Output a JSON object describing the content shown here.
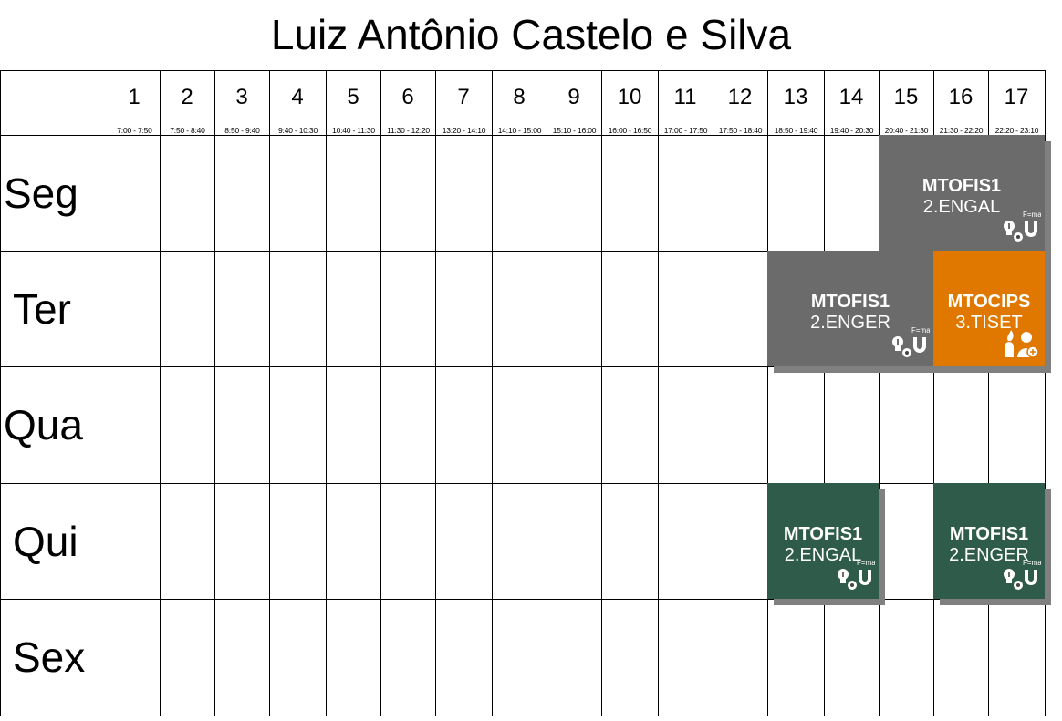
{
  "title": "Luiz Antônio Castelo e Silva",
  "columns": [
    {
      "num": "1",
      "time": "7:00 - 7:50"
    },
    {
      "num": "2",
      "time": "7:50 - 8:40"
    },
    {
      "num": "3",
      "time": "8:50 - 9:40"
    },
    {
      "num": "4",
      "time": "9:40 - 10:30"
    },
    {
      "num": "5",
      "time": "10:40 - 11:30"
    },
    {
      "num": "6",
      "time": "11:30 - 12:20"
    },
    {
      "num": "7",
      "time": "13:20 - 14:10"
    },
    {
      "num": "8",
      "time": "14:10 - 15:00"
    },
    {
      "num": "9",
      "time": "15:10 - 16:00"
    },
    {
      "num": "10",
      "time": "16:00 - 16:50"
    },
    {
      "num": "11",
      "time": "17:00 - 17:50"
    },
    {
      "num": "12",
      "time": "17:50 - 18:40"
    },
    {
      "num": "13",
      "time": "18:50 - 19:40"
    },
    {
      "num": "14",
      "time": "19:40 - 20:30"
    },
    {
      "num": "15",
      "time": "20:40 - 21:30"
    },
    {
      "num": "16",
      "time": "21:30 - 22:20"
    },
    {
      "num": "17",
      "time": "22:20 - 23:10"
    }
  ],
  "days": [
    "Seg",
    "Ter",
    "Qua",
    "Qui",
    "Sex"
  ],
  "colors": {
    "gray": "#6b6b6b",
    "orange": "#e07800",
    "green": "#2e5b4a",
    "shadow": "#808080"
  },
  "blocks": [
    {
      "day": 0,
      "start": 15,
      "end": 17,
      "code": "MTOFIS1",
      "class": "2.ENGAL",
      "color": "gray",
      "icon": "physics-icon"
    },
    {
      "day": 1,
      "start": 13,
      "end": 15,
      "code": "MTOFIS1",
      "class": "2.ENGER",
      "color": "gray",
      "icon": "physics-icon"
    },
    {
      "day": 1,
      "start": 16,
      "end": 17,
      "code": "MTOCIPS",
      "class": "3.TISET",
      "color": "orange",
      "icon": "safety-icon"
    },
    {
      "day": 3,
      "start": 13,
      "end": 14,
      "code": "MTOFIS1",
      "class": "2.ENGAL",
      "color": "green",
      "icon": "physics-icon"
    },
    {
      "day": 3,
      "start": 16,
      "end": 17,
      "code": "MTOFIS1",
      "class": "2.ENGER",
      "color": "green",
      "icon": "physics-icon"
    }
  ]
}
